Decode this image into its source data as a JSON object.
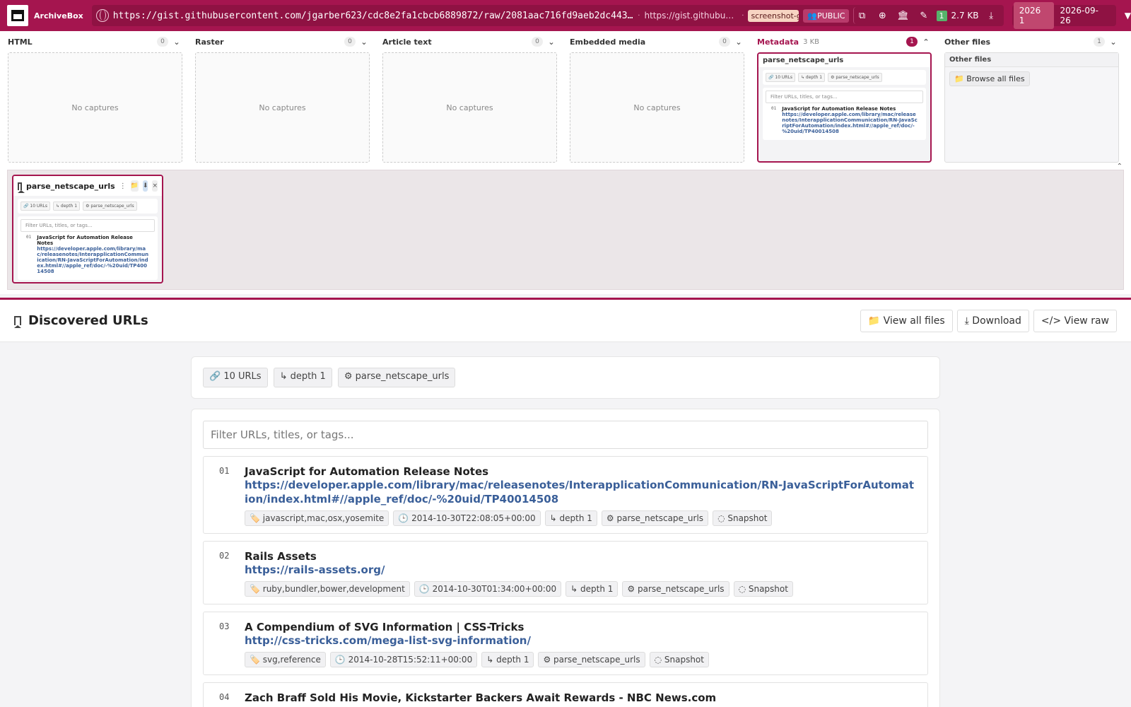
{
  "app": {
    "name": "ArchiveBox",
    "url": "https://gist.githubusercontent.com/jgarber623/cdc8e2fa1cbcb6889872/raw/2081aac716fd9aeb2dc443cd7…",
    "url_short": "https://gist.githubuserc…",
    "tag": "screenshot-gall",
    "visibility": "👥PUBLIC",
    "file_count": "1",
    "size": "2.7 KB",
    "year": "2026 1",
    "date": "2026-09-26"
  },
  "tiles": [
    {
      "label": "HTML",
      "count": "0",
      "empty": "No captures"
    },
    {
      "label": "Raster",
      "count": "0",
      "empty": "No captures"
    },
    {
      "label": "Article text",
      "count": "0",
      "empty": "No captures"
    },
    {
      "label": "Embedded media",
      "count": "0",
      "empty": "No captures"
    }
  ],
  "metadata_tile": {
    "label": "Metadata",
    "size": "3 KB",
    "count": "1",
    "card_title": "parse_netscape_urls"
  },
  "other_tile": {
    "label": "Other files",
    "count": "1",
    "box_title": "Other files",
    "browse_label": "📁 Browse all files"
  },
  "preview": {
    "title": "parse_netscape_urls",
    "more": "⋮",
    "folder_icon": "📁",
    "download_icon": "⬇",
    "close_icon": "×"
  },
  "section": {
    "title": "Discovered URLs",
    "view_all_label": "📁 View all files",
    "download_label": "⤓ Download",
    "view_raw_label": "</> View raw"
  },
  "summary": {
    "urls": "🔗 10 URLs",
    "depth": "↳ depth 1",
    "parser": "⚙ parse_netscape_urls"
  },
  "filter": {
    "placeholder": "Filter URLs, titles, or tags..."
  },
  "urls": [
    {
      "num": "01",
      "title": "JavaScript for Automation Release Notes",
      "url": "https://developer.apple.com/library/mac/releasenotes/InterapplicationCommunication/RN-JavaScriptForAutomation/index.html#//apple_ref/doc/-%20uid/TP40014508",
      "tags": "🏷️ javascript,mac,osx,yosemite",
      "timestamp": "🕒 2014-10-30T22:08:05+00:00",
      "depth": "↳ depth 1",
      "parser": "⚙ parse_netscape_urls",
      "snapshot": "◌ Snapshot"
    },
    {
      "num": "02",
      "title": "Rails Assets",
      "url": "https://rails-assets.org/",
      "tags": "🏷️ ruby,bundler,bower,development",
      "timestamp": "🕒 2014-10-30T01:34:00+00:00",
      "depth": "↳ depth 1",
      "parser": "⚙ parse_netscape_urls",
      "snapshot": "◌ Snapshot"
    },
    {
      "num": "03",
      "title": "A Compendium of SVG Information | CSS-Tricks",
      "url": "http://css-tricks.com/mega-list-svg-information/",
      "tags": "🏷️ svg,reference",
      "timestamp": "🕒 2014-10-28T15:52:11+00:00",
      "depth": "↳ depth 1",
      "parser": "⚙ parse_netscape_urls",
      "snapshot": "◌ Snapshot"
    },
    {
      "num": "04",
      "title": "Zach Braff Sold His Movie, Kickstarter Backers Await Rewards - NBC News.com",
      "url": "",
      "tags": "",
      "timestamp": "",
      "depth": "",
      "parser": "",
      "snapshot": ""
    }
  ],
  "mini": {
    "urls": "🔗 10 URLs",
    "depth": "↳ depth 1",
    "parser": "⚙ parse_netscape_urls",
    "filter": "Filter URLs, titles, or tags...",
    "num": "01",
    "title": "JavaScript for Automation Release Notes",
    "url": "https://developer.apple.com/library/mac/releasenotes/InterapplicationCommunication/RN-JavaScriptForAutomation/index.html#//apple_ref/doc/-%20uid/TP40014508"
  },
  "icons": {
    "copy": "⧉",
    "globe": "⊕",
    "archive": "🏛",
    "edit": "✎",
    "download": "⤓",
    "caret_down": "⌄",
    "caret_up": "⌃"
  }
}
